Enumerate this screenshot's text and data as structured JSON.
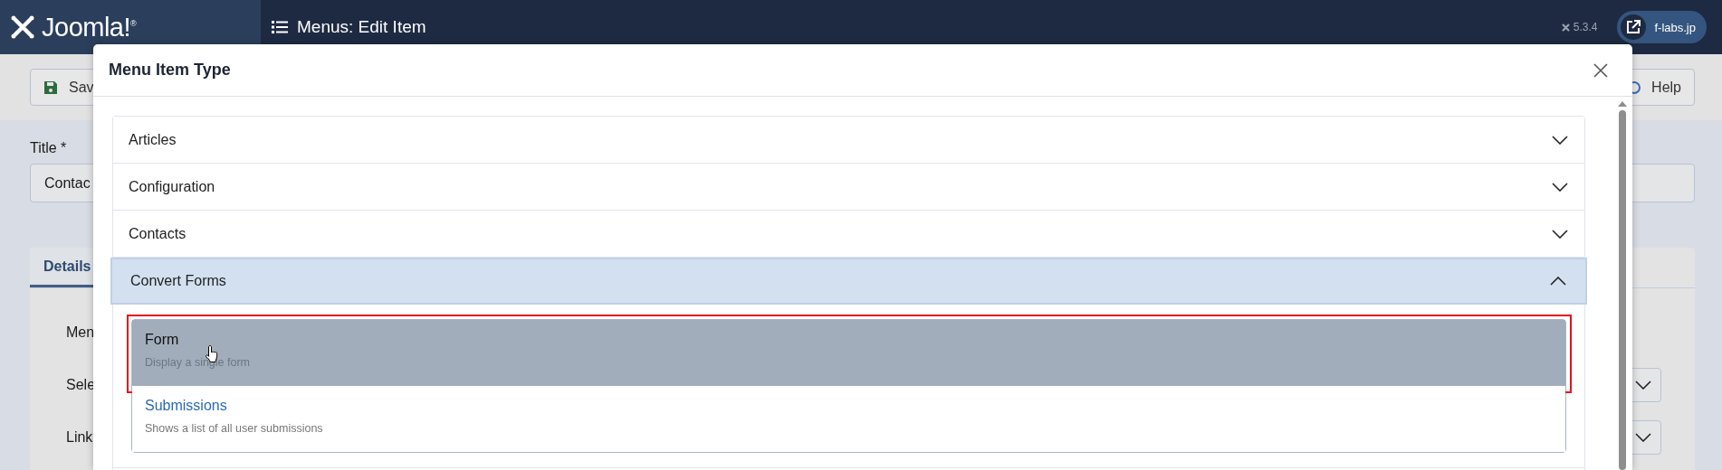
{
  "header": {
    "brand": "Joomla!$^{®}$",
    "page_title": "Menus: Edit Item",
    "version": "5.3.4",
    "site_link": "f-labs.jp"
  },
  "toolbar": {
    "buttons": [
      "Sav",
      "Help"
    ]
  },
  "form": {
    "title_label": "Title *",
    "title_value": "Contac",
    "tabs": [
      {
        "label": "Details",
        "selected": true
      }
    ],
    "field_labels": [
      "Men",
      "Sele",
      "Link"
    ]
  },
  "modal": {
    "title": "Menu Item Type",
    "groups": [
      {
        "label": "Articles",
        "expanded": false
      },
      {
        "label": "Configuration",
        "expanded": false
      },
      {
        "label": "Contacts",
        "expanded": false
      },
      {
        "label": "Convert Forms",
        "expanded": true,
        "items": [
          {
            "title": "Form",
            "description": "Display a single form",
            "selected": true,
            "highlighted": true
          },
          {
            "title": "Submissions",
            "description": "Shows a list of all user submissions",
            "selected": false,
            "highlighted": false
          }
        ]
      }
    ]
  }
}
